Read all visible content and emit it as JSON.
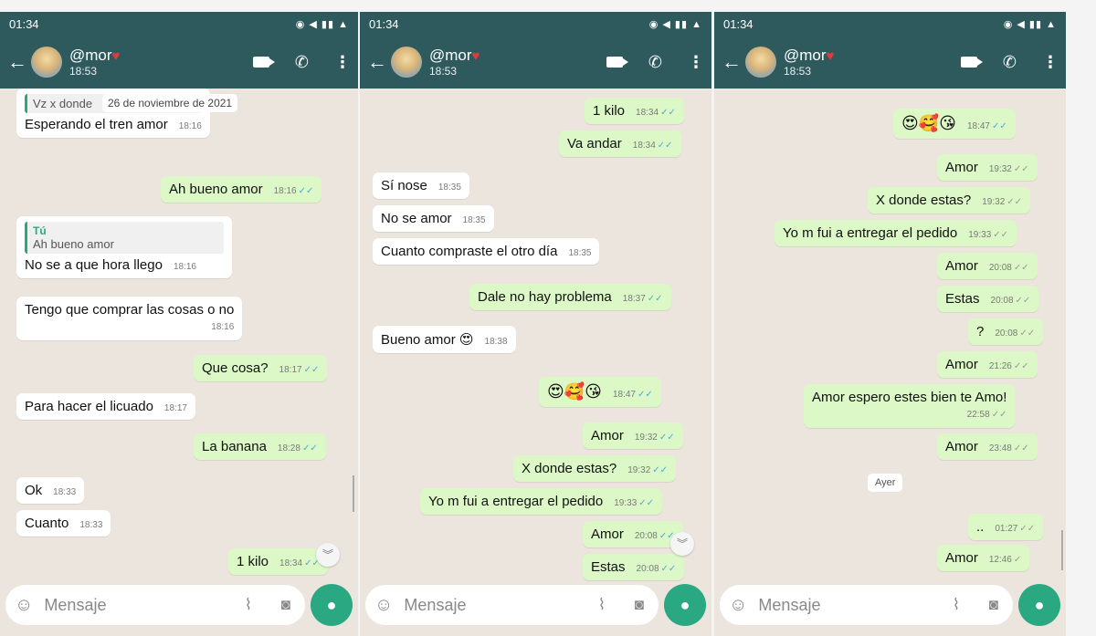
{
  "panels": [
    {
      "status_time": "01:34",
      "contact": {
        "name": "@mor",
        "last_seen": "18:53"
      },
      "date_chip": "26 de noviembre de 2021",
      "input_placeholder": "Mensaje",
      "messages": [
        {
          "type": "in",
          "quote_text": "Vz x donde",
          "text": "Esperando el tren amor",
          "time": "18:16"
        },
        {
          "type": "out",
          "text": "Ah bueno amor",
          "time": "18:16",
          "check": "✓✓"
        },
        {
          "type": "in",
          "quote_author": "Tú",
          "quote_text": "Ah bueno amor",
          "text": "No se a que hora llego",
          "time": "18:16"
        },
        {
          "type": "in",
          "text": "Tengo que comprar las cosas o no",
          "time": "18:16"
        },
        {
          "type": "out",
          "text": "Que cosa?",
          "time": "18:17",
          "check": "✓✓"
        },
        {
          "type": "in",
          "text": "Para hacer el licuado",
          "time": "18:17"
        },
        {
          "type": "out",
          "text": "La banana",
          "time": "18:28",
          "check": "✓✓"
        },
        {
          "type": "in",
          "text": "Ok",
          "time": "18:33"
        },
        {
          "type": "in",
          "text": "Cuanto",
          "time": "18:33"
        },
        {
          "type": "out",
          "text": "1 kilo",
          "time": "18:34",
          "check": "✓✓"
        }
      ]
    },
    {
      "status_time": "01:34",
      "contact": {
        "name": "@mor",
        "last_seen": "18:53"
      },
      "input_placeholder": "Mensaje",
      "messages": [
        {
          "type": "out",
          "text": "1 kilo",
          "time": "18:34",
          "check": "✓✓"
        },
        {
          "type": "out",
          "text": "Va andar",
          "time": "18:34",
          "check": "✓✓"
        },
        {
          "type": "in",
          "text": "Sí nose",
          "time": "18:35"
        },
        {
          "type": "in",
          "text": "No se amor",
          "time": "18:35"
        },
        {
          "type": "in",
          "text": "Cuanto compraste el otro día",
          "time": "18:35"
        },
        {
          "type": "out",
          "text": "Dale no hay problema",
          "time": "18:37",
          "check": "✓✓"
        },
        {
          "type": "in",
          "text": "Bueno amor 😍",
          "time": "18:38"
        },
        {
          "type": "out",
          "text": "😍🥰😘",
          "time": "18:47",
          "check": "✓✓"
        },
        {
          "type": "out",
          "text": "Amor",
          "time": "19:32",
          "check": "✓✓"
        },
        {
          "type": "out",
          "text": "X donde estas?",
          "time": "19:32",
          "check": "✓✓"
        },
        {
          "type": "out",
          "text": "Yo m fui a entregar el pedido",
          "time": "19:33",
          "check": "✓✓"
        },
        {
          "type": "out",
          "text": "Amor",
          "time": "20:08",
          "check": "✓✓"
        },
        {
          "type": "out",
          "text": "Estas",
          "time": "20:08",
          "check": "✓✓"
        }
      ]
    },
    {
      "status_time": "01:34",
      "contact": {
        "name": "@mor",
        "last_seen": "18:53"
      },
      "input_placeholder": "Mensaje",
      "day_chip": "Ayer",
      "messages": [
        {
          "type": "out",
          "text": "😍🥰😘",
          "time": "18:47",
          "check": "✓✓"
        },
        {
          "type": "out",
          "text": "Amor",
          "time": "19:32",
          "check": "✓✓"
        },
        {
          "type": "out",
          "text": "X donde estas?",
          "time": "19:32",
          "check": "✓✓"
        },
        {
          "type": "out",
          "text": "Yo m fui a entregar el pedido",
          "time": "19:33",
          "check": "✓✓"
        },
        {
          "type": "out",
          "text": "Amor",
          "time": "20:08",
          "check": "✓✓"
        },
        {
          "type": "out",
          "text": "Estas",
          "time": "20:08",
          "check": "✓✓"
        },
        {
          "type": "out",
          "text": "?",
          "time": "20:08",
          "check": "✓✓"
        },
        {
          "type": "out",
          "text": "Amor",
          "time": "21:26",
          "check": "✓✓"
        },
        {
          "type": "out",
          "text": "Amor espero estes bien te Amo!",
          "time": "22:58",
          "check": "✓✓"
        },
        {
          "type": "out",
          "text": "Amor",
          "time": "23:48",
          "check": "✓✓"
        },
        {
          "type": "out",
          "text": "..",
          "time": "01:27",
          "check": "✓✓"
        },
        {
          "type": "out",
          "text": "Amor",
          "time": "12:46",
          "check": "✓"
        }
      ]
    }
  ],
  "colors": {
    "header": "#2f5a5d",
    "chat_bg": "#ece5dd",
    "outgoing": "#dcf8c6",
    "incoming": "#ffffff",
    "read_check": "#4fa8d8",
    "mic_button": "#2aa881"
  },
  "icons": [
    "back-arrow-icon",
    "video-call-icon",
    "phone-icon",
    "more-options-icon",
    "emoji-icon",
    "attach-icon",
    "camera-icon",
    "microphone-icon",
    "scroll-down-icon"
  ]
}
